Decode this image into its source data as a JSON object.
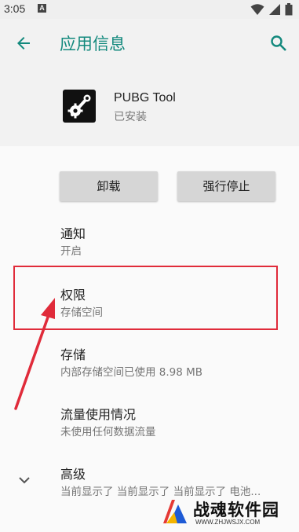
{
  "status_bar": {
    "time": "3:05",
    "notification_icon": "A",
    "icons": [
      "wifi-icon",
      "signal-icon",
      "battery-icon"
    ]
  },
  "app_bar": {
    "title": "应用信息",
    "back_icon": "arrow-back-icon",
    "search_icon": "search-icon",
    "accent": "#13897d"
  },
  "app": {
    "name": "PUBG Tool",
    "status": "已安装",
    "icon": "gear-wrench-icon"
  },
  "buttons": {
    "uninstall": "卸载",
    "force_stop": "强行停止"
  },
  "rows": [
    {
      "title": "通知",
      "subtitle": "开启"
    },
    {
      "title": "权限",
      "subtitle": "存储空间"
    },
    {
      "title": "存储",
      "subtitle": "内部存储空间已使用 8.98 MB"
    },
    {
      "title": "流量使用情况",
      "subtitle": "未使用任何数据流量"
    },
    {
      "title": "高级",
      "subtitle": "当前显示了 当前显示了 当前显示了 电池..."
    }
  ],
  "annotation": {
    "color": "#e02b3a"
  },
  "watermark": {
    "text": "战魂软件园",
    "url": "WWW.ZHJWSJX.COM"
  }
}
